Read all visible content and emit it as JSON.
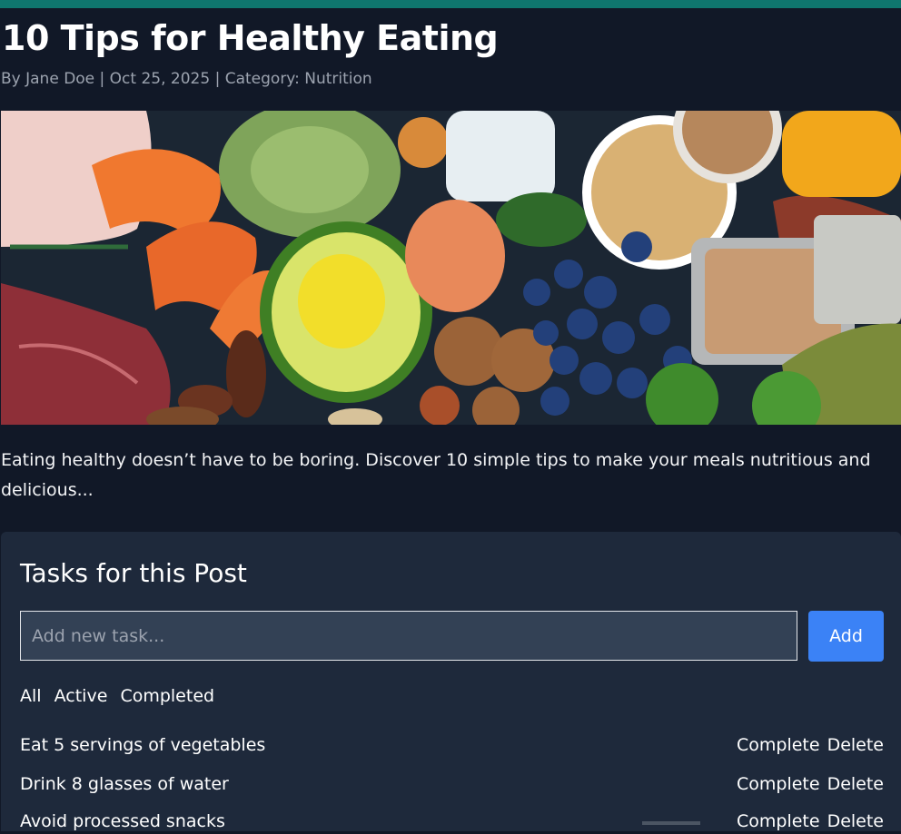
{
  "post": {
    "title": "10 Tips for Healthy Eating",
    "meta": "By Jane Doe | Oct 25, 2025 | Category: Nutrition",
    "intro": "Eating healthy doesn’t have to be boring. Discover 10 simple tips to make your meals nutritious and delicious..."
  },
  "tasks_panel": {
    "heading": "Tasks for this Post",
    "input_placeholder": "Add new task...",
    "add_label": "Add",
    "filters": [
      "All",
      "Active",
      "Completed"
    ],
    "complete_label": "Complete",
    "delete_label": "Delete",
    "items": [
      {
        "label": "Eat 5 servings of vegetables"
      },
      {
        "label": "Drink 8 glasses of water"
      },
      {
        "label": "Avoid processed snacks"
      }
    ]
  },
  "colors": {
    "background": "#111827",
    "panel": "#1e293b",
    "accent": "#3b82f6",
    "top_bar": "#0f766e"
  }
}
